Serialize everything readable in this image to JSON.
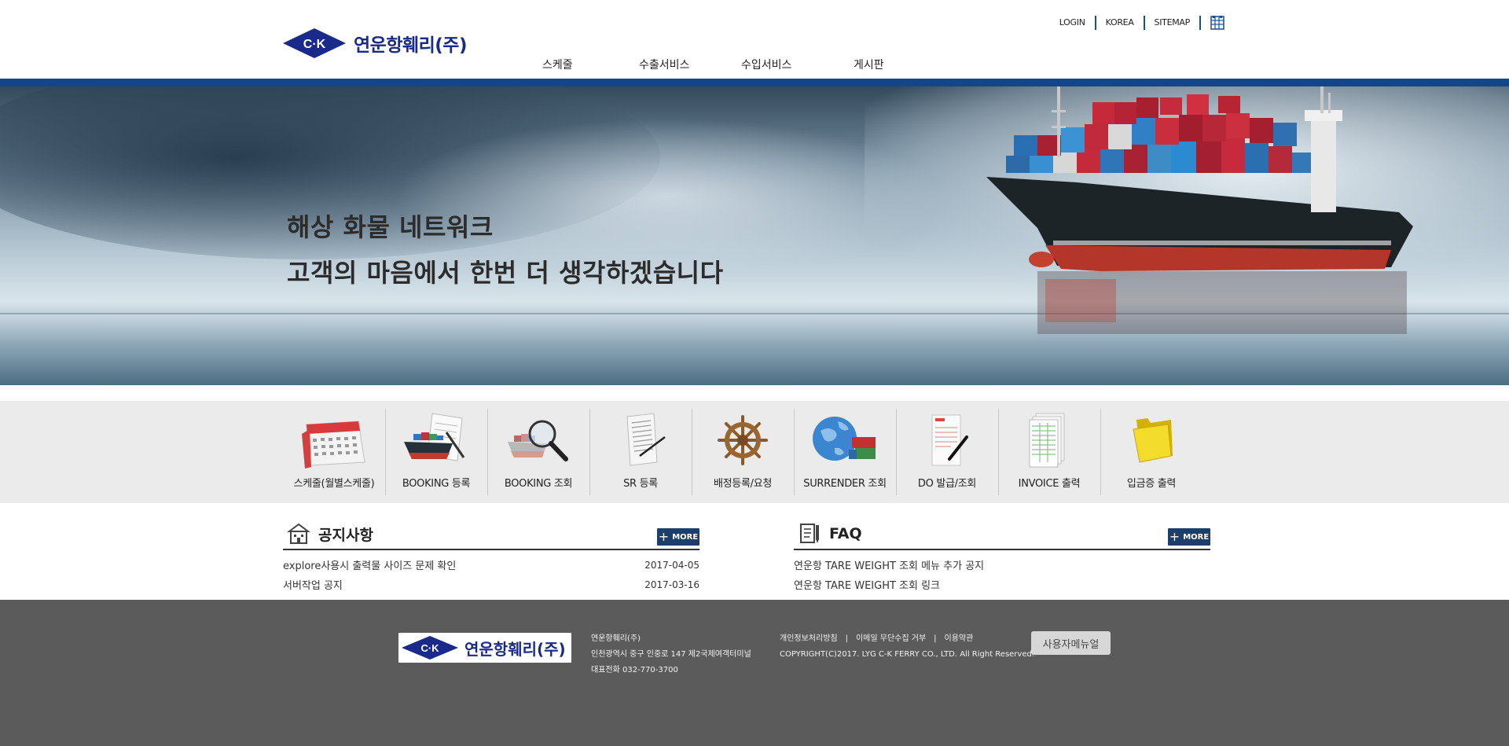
{
  "brand": {
    "logo_mark": "C·K",
    "name": "연운항훼리(주)"
  },
  "util_nav": {
    "login": "LOGIN",
    "korea": "KOREA",
    "sitemap": "SITEMAP",
    "icon": "grid-icon"
  },
  "gnb": {
    "items": [
      "스케줄",
      "수출서비스",
      "수입서비스",
      "게시판"
    ]
  },
  "hero": {
    "line1": "해상 화물 네트워크",
    "line2": "고객의 마음에서 한번 더 생각하겠습니다"
  },
  "quick_menu": {
    "items": [
      {
        "label": "스케줄(월별스케줄)",
        "icon": "calendar-icon"
      },
      {
        "label": "BOOKING 등록",
        "icon": "ship-pen-icon"
      },
      {
        "label": "BOOKING 조회",
        "icon": "ship-magnifier-icon"
      },
      {
        "label": "SR 등록",
        "icon": "document-pen-icon"
      },
      {
        "label": "배정등록/요청",
        "icon": "ship-wheel-icon"
      },
      {
        "label": "SURRENDER 조회",
        "icon": "globe-containers-icon"
      },
      {
        "label": "DO 발급/조회",
        "icon": "invoice-pen-icon"
      },
      {
        "label": "INVOICE 출력",
        "icon": "spreadsheet-icon"
      },
      {
        "label": "입금증 출력",
        "icon": "folder-icon"
      }
    ]
  },
  "notice": {
    "title": "공지사항",
    "more_label": "MORE",
    "items": [
      {
        "title": "explore사용시 출력물 사이즈  문제 확인",
        "date": "2017-04-05"
      },
      {
        "title": "서버작업 공지",
        "date": "2017-03-16"
      }
    ]
  },
  "faq": {
    "title": "FAQ",
    "more_label": "MORE",
    "items": [
      {
        "title": "연운항 TARE WEIGHT 조회 메뉴 추가 공지"
      },
      {
        "title": "연운항 TARE WEIGHT 조회 링크"
      }
    ]
  },
  "footer": {
    "company": "연운항훼리(주)",
    "address": "인천광역시 중구 인중로 147 제2국제여객터미널",
    "phone": "대표전화 032-770-3700",
    "privacy": "개인정보처리방침",
    "email_refuse": "이메일 무단수집 거부",
    "terms": "이용약관",
    "sep": "|",
    "copyright": "COPYRIGHT(C)2017. LYG C-K FERRY CO., LTD. All Right Reserved.",
    "manual_button": "사용자메뉴얼"
  },
  "colors": {
    "brand_navy": "#1a2a8a",
    "top_bar": "#11478a",
    "more_bg": "#1b3e6a",
    "footer_bg": "#5b5b5b",
    "quick_bg": "#ebebeb"
  }
}
